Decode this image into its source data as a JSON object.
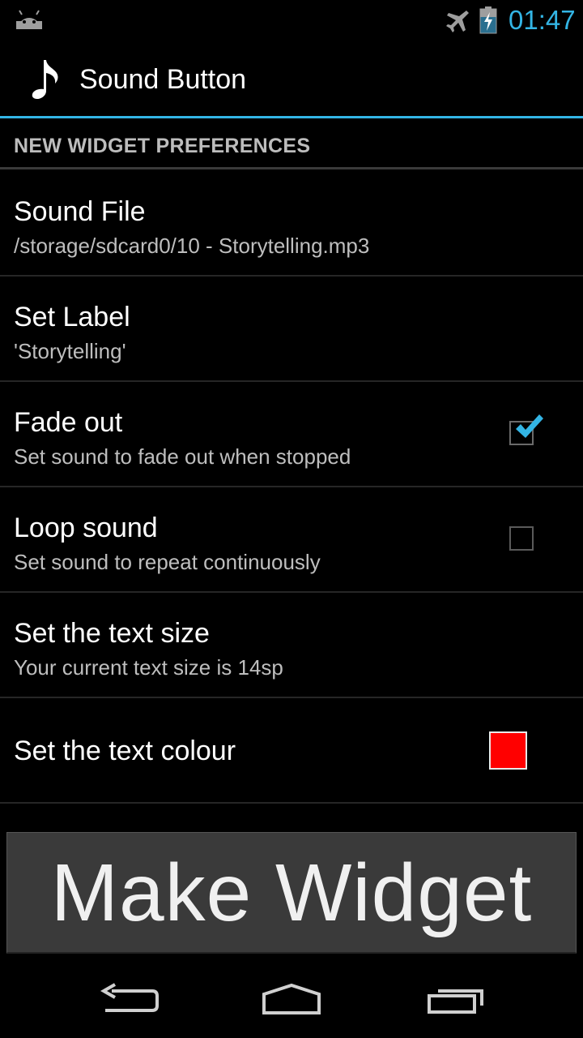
{
  "status_bar": {
    "time": "01:47",
    "icons": [
      "android-icon",
      "airplane-mode-icon",
      "battery-charging-icon"
    ],
    "accent_color": "#33b5e5"
  },
  "action_bar": {
    "title": "Sound Button",
    "icon": "music-note-icon"
  },
  "category": {
    "title": "NEW WIDGET PREFERENCES"
  },
  "preferences": [
    {
      "title": "Sound File",
      "summary": "/storage/sdcard0/10 - Storytelling.mp3"
    },
    {
      "title": "Set Label",
      "summary": "'Storytelling'"
    },
    {
      "title": "Fade out",
      "summary": "Set sound to fade out when stopped",
      "checked": true
    },
    {
      "title": "Loop sound",
      "summary": "Set sound to repeat continuously",
      "checked": false
    },
    {
      "title": "Set the text size",
      "summary": "Your current text size is 14sp"
    },
    {
      "title": "Set the text colour",
      "color": "#ff0000"
    }
  ],
  "button": {
    "label": "Make Widget"
  },
  "nav_bar": {
    "icons": [
      "back-icon",
      "home-icon",
      "recent-apps-icon"
    ]
  }
}
